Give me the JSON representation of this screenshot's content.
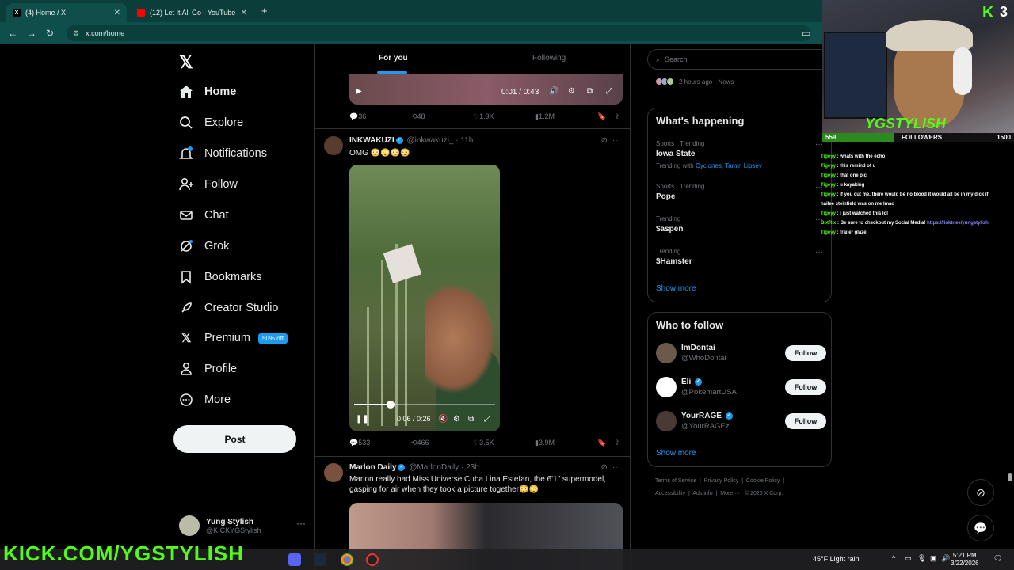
{
  "browser": {
    "tabs": [
      {
        "title": "(4) Home / X",
        "favicon": "X",
        "active": true
      },
      {
        "title": "(12) Let It All Go - YouTube",
        "favicon": "yt",
        "active": false
      }
    ],
    "url": "x.com/home"
  },
  "x": {
    "nav": [
      {
        "label": "Home",
        "icon": "home-icon"
      },
      {
        "label": "Explore",
        "icon": "search-icon"
      },
      {
        "label": "Notifications",
        "icon": "bell-icon"
      },
      {
        "label": "Follow",
        "icon": "person-plus-icon"
      },
      {
        "label": "Chat",
        "icon": "mail-icon"
      },
      {
        "label": "Grok",
        "icon": "grok-icon"
      },
      {
        "label": "Bookmarks",
        "icon": "bookmark-icon"
      },
      {
        "label": "Creator Studio",
        "icon": "rocket-icon"
      },
      {
        "label": "Premium",
        "icon": "x-icon",
        "badge": "50% off"
      },
      {
        "label": "Profile",
        "icon": "person-icon"
      },
      {
        "label": "More",
        "icon": "more-circle-icon"
      }
    ],
    "post_label": "Post",
    "profile": {
      "name": "Yung Stylish",
      "handle": "@KICKYGStylish"
    },
    "feed_tabs": {
      "for_you": "For you",
      "following": "Following"
    },
    "top_video": {
      "time": "0:01 / 0:43"
    },
    "top_actions": {
      "replies": "36",
      "reposts": "48",
      "likes": "1.9K",
      "views": "1.2M"
    },
    "tweet1": {
      "name": "INKWAKUZI",
      "handle": "@inkwakuzi_",
      "time": "11h",
      "text": "OMG 😳😳😳😳",
      "video_time": "0:06 / 0:26",
      "progress": 0.26,
      "replies": "533",
      "reposts": "466",
      "likes": "3.5K",
      "views": "3.9M"
    },
    "tweet2": {
      "name": "Marlon Daily",
      "handle": "@MarlonDaily",
      "time": "23h",
      "text_line1": "Marlon really had Miss Universe Cuba Lina Estefan, the 6'1\" supermodel,",
      "text_line2": "gasping for air when they took a picture together😳😳"
    },
    "search_placeholder": "Search",
    "news_line": "2 hours ago · News ·",
    "whats_happening": {
      "title": "What's happening",
      "trends": [
        {
          "category": "Sports · Trending",
          "name": "Iowa State",
          "with_label": "Trending with",
          "with": "Cyclones, Tamin Lipsey"
        },
        {
          "category": "Sports · Trending",
          "name": "Pope"
        },
        {
          "category": "Trending",
          "name": "$aspen"
        },
        {
          "category": "Trending",
          "name": "$Hamster"
        }
      ],
      "show_more": "Show more"
    },
    "who_to_follow": {
      "title": "Who to follow",
      "users": [
        {
          "name": "ImDontai",
          "handle": "@WhoDontai",
          "verified": false,
          "button": "Follow"
        },
        {
          "name": "Eli",
          "handle": "@PokemartUSA",
          "verified": true,
          "button": "Follow"
        },
        {
          "name": "YourRAGE",
          "handle": "@YourRAGEz",
          "verified": true,
          "button": "Follow"
        }
      ],
      "show_more": "Show more"
    },
    "footer": {
      "terms": "Terms of Service",
      "privacy": "Privacy Policy",
      "cookie": "Cookie Policy",
      "accessibility": "Accessibility",
      "ads": "Ads info",
      "more": "More ···",
      "copyright": "© 2026 X Corp."
    }
  },
  "stream": {
    "viewers": "3",
    "tag": "YGSTYLISH",
    "followers": {
      "current": "559",
      "label": "FOLLOWERS",
      "goal": "1500",
      "fraction": 0.373
    },
    "chat": [
      {
        "user": "Tigeyy",
        "msg": "whats with the echo"
      },
      {
        "user": "Tigeyy",
        "msg": "this remind of u"
      },
      {
        "user": "Tigeyy",
        "msg": "that one pic"
      },
      {
        "user": "Tigeyy",
        "msg": "u kayaking"
      },
      {
        "user": "Tigeyy",
        "msg": "if you cut me, there would be no blood it would all be in my dick if"
      },
      {
        "user": "",
        "msg": "hailee steinfield was on me lmao"
      },
      {
        "user": "Tigeyy",
        "msg": "i just watched this lol"
      },
      {
        "user": "BotRix",
        "msg": "Be sure to checkout my Social Media!",
        "link": "https://linktr.ee/yungstylish"
      },
      {
        "user": "Tigeyy",
        "msg": "trailer glaze"
      }
    ],
    "banner": "KICK.COM/YGSTYLISH"
  },
  "taskbar": {
    "weather": "45°F  Light rain",
    "time": "5:21 PM",
    "date": "3/22/2026"
  }
}
